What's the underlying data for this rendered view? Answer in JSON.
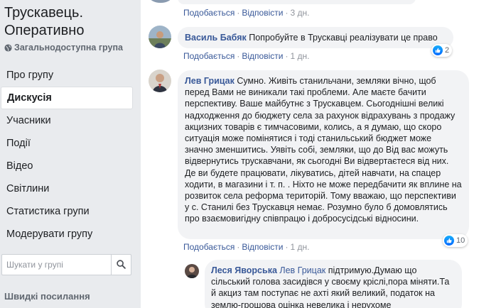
{
  "sidebar": {
    "group_title": "Трускавець. Оперативно",
    "group_type": "Загальнодоступна група",
    "nav": [
      {
        "label": "Про групу",
        "active": false
      },
      {
        "label": "Дискусія",
        "active": true
      },
      {
        "label": "Учасники",
        "active": false
      },
      {
        "label": "Події",
        "active": false
      },
      {
        "label": "Відео",
        "active": false
      },
      {
        "label": "Світлини",
        "active": false
      },
      {
        "label": "Статистика групи",
        "active": false
      },
      {
        "label": "Модерувати групу",
        "active": false
      }
    ],
    "search_placeholder": "Шукати у групі",
    "quick_links": "Швидкі посилання"
  },
  "feed": {
    "comment0_actions": {
      "like": "Подобається",
      "reply": "Відповісти",
      "time": "3 дн."
    },
    "comments": [
      {
        "author": "Василь Бабяк",
        "text": "Попробуйте в Трускавці реалізувати це право",
        "like": "Подобається",
        "reply": "Відповісти",
        "time": "1 дн.",
        "reactions": "2"
      },
      {
        "author": "Лев Грицак",
        "text": "Сумно. Живіть станильчани, земляки вічно, щоб перед Вами не виникали такі проблеми. Але маєте бачити перспективу. Ваше майбутнє з Трускавцем. Сьогоднішні великі надходження до бюджету села за рахунок відрахувань з продажу акцизних товарів є тимчасовими, колись, а я думаю, що скоро ситуація може помінятися і тоді станильський бюджет може значно зменшитись. Уявіть собі, земляки, що до Від вас можуть відвернутись трускавчани, як сьогодні Ви відвертаєтеся від них. Де ви будете працювати, лікуватись, дітей навчати, на спацер ходити, в магазини і т. п. . Ніхто не може передбачити як вплине на розвиток села реформа територій. Тому вважаю, що перспективи у с. Станилі без Трускавця немає. Розумно було б домовлятись про взаємовигідну співпрацю і добросусідські відносини.",
        "like": "Подобається",
        "reply": "Відповісти",
        "time": "1 дн.",
        "reactions": "10"
      }
    ],
    "reply": {
      "author": "Леся Яворська",
      "mention": "Лев Грицак",
      "text": "підтримую.Думаю що сільський голова засидівся у своєму кріслі,пора міняти.Та й акциз там поступає не ахті який великий, податок на землю-грошова оцінка невелика і нерухоме"
    }
  },
  "colors": {
    "link": "#385898",
    "bubble": "#f2f3f5",
    "like_blue": "#0569ff",
    "page_bg": "#e9ebee"
  }
}
